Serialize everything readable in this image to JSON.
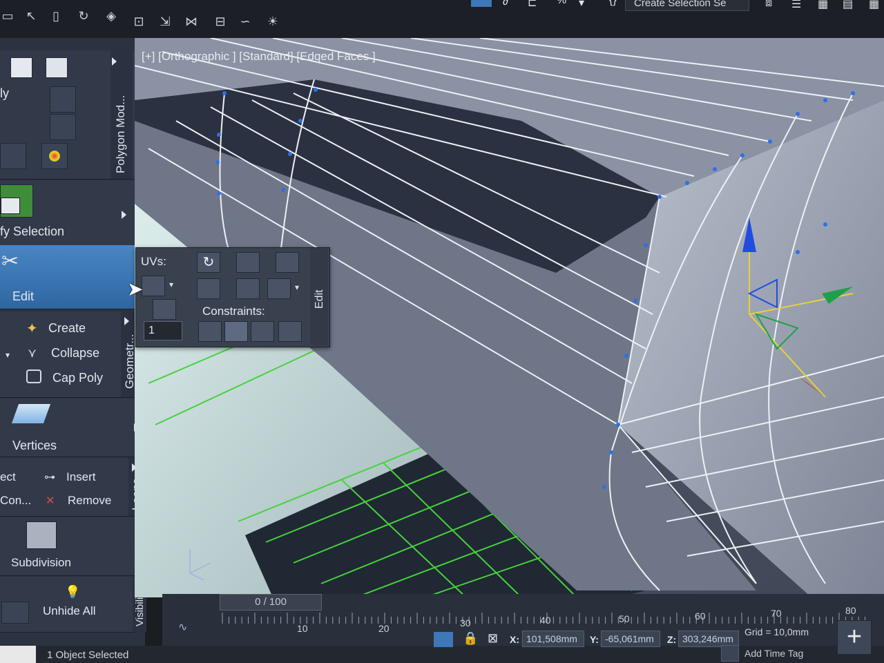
{
  "toolbar": {
    "selection_set_placeholder": "Create Selection Se",
    "percent_label": "%"
  },
  "ribbon": {
    "polygon_modeling_tab": "Polygon Mod...",
    "ply_label": "ly",
    "modify_selection_label": "fy Selection",
    "edit_label": "Edit",
    "geometry_tab": "Geometr...",
    "geometry_items": [
      "Create",
      "Collapse",
      "Cap Poly"
    ],
    "vertices_label": "Vertices",
    "loops_tab": "Loops",
    "loops_left_labels": [
      "ect",
      "Con..."
    ],
    "loops_items": [
      "Insert",
      "Remove"
    ],
    "subdivision_label": "Subdivision",
    "visibility_tab": "Visibility",
    "unhide_all_label": "Unhide All"
  },
  "viewport": {
    "label": "[+] [Orthographic ] [Standard] [Edged Faces ]"
  },
  "popup": {
    "uvs_label": "UVs:",
    "constraints_label": "Constraints:",
    "edit_tab": "Edit",
    "uv_channel_value": "1"
  },
  "timeline": {
    "frame_display": "0 / 100",
    "ticks": [
      "10",
      "20",
      "30",
      "40",
      "50",
      "60",
      "70",
      "80"
    ]
  },
  "status": {
    "selection_text": "1 Object Selected",
    "x_label": "X:",
    "x_value": "101,508mm",
    "y_label": "Y:",
    "y_value": "-65,061mm",
    "z_label": "Z:",
    "z_value": "303,246mm",
    "grid_text": "Grid = 10,0mm",
    "add_time_tag": "Add Time Tag"
  },
  "colors": {
    "ribbon_bg": "#2b3240",
    "panel_bg": "#323a4a",
    "edit_active": "#3d78b8",
    "viewport_bg": "#555d6e",
    "grid_green": "#41c83a",
    "vertex_blue": "#2f6fe8",
    "axis_z": "#1f4de0",
    "axis_y": "#1ea04a",
    "axis_x": "#d82a2a"
  },
  "icons": [
    "scissors-icon",
    "cube-icon",
    "lock-icon",
    "refresh-icon",
    "plus-icon",
    "bulb-icon"
  ]
}
